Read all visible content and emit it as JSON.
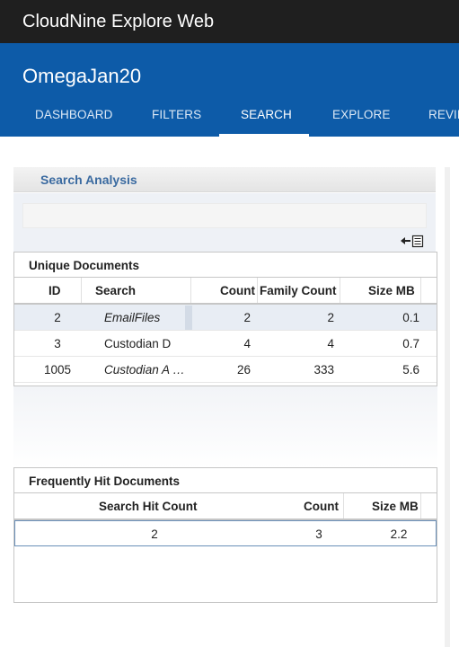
{
  "app": {
    "title": "CloudNine Explore Web"
  },
  "project": {
    "name": "OmegaJan20"
  },
  "tabs": [
    "DASHBOARD",
    "FILTERS",
    "SEARCH",
    "EXPLORE",
    "REVIE"
  ],
  "panel": {
    "title": "Search Analysis"
  },
  "unique_docs": {
    "caption": "Unique Documents",
    "headers": {
      "id": "ID",
      "search": "Search",
      "count": "Count",
      "family_count": "Family Count",
      "size": "Size MB"
    },
    "rows": [
      {
        "id": "2",
        "search": "EmailFiles",
        "count": "2",
        "family_count": "2",
        "size": "0.1"
      },
      {
        "id": "3",
        "search": "Custodian D",
        "count": "4",
        "family_count": "4",
        "size": "0.7"
      },
      {
        "id": "1005",
        "search": "Custodian A …",
        "count": "26",
        "family_count": "333",
        "size": "5.6"
      }
    ]
  },
  "frequent_docs": {
    "caption": "Frequently Hit Documents",
    "headers": {
      "hit_count": "Search Hit Count",
      "count": "Count",
      "size": "Size MB"
    },
    "rows": [
      {
        "hit_count": "2",
        "count": "3",
        "size": "2.2"
      }
    ]
  }
}
